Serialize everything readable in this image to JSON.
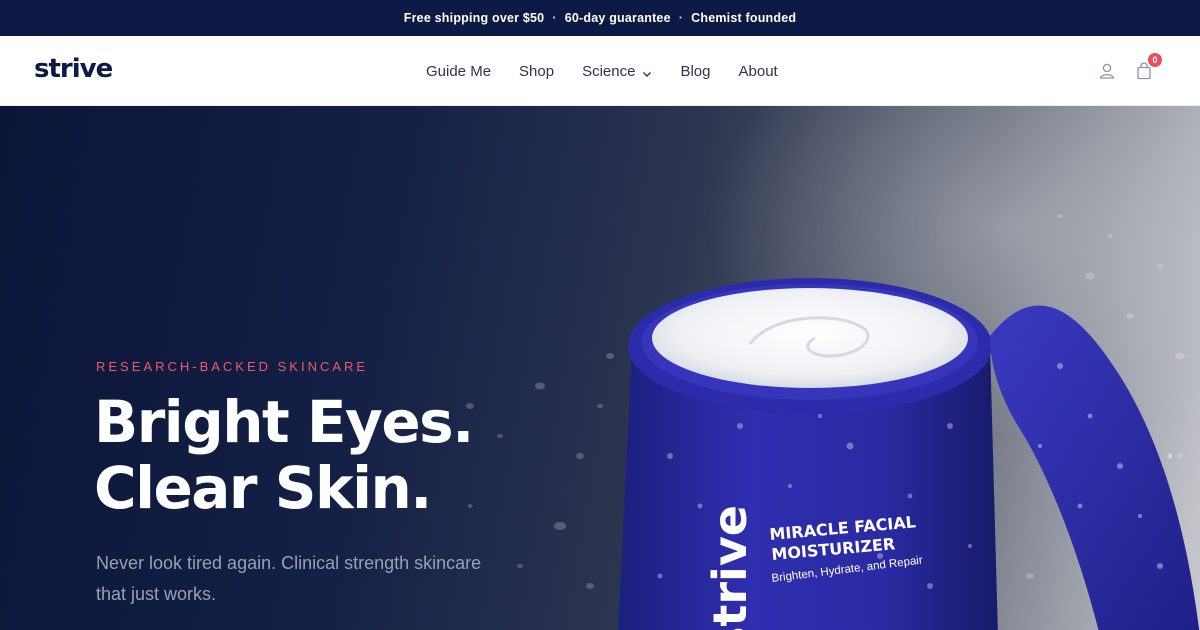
{
  "announcement": {
    "items": [
      "Free shipping over $50",
      "60-day guarantee",
      "Chemist founded"
    ],
    "separator": "·"
  },
  "header": {
    "logo": "strive",
    "nav": [
      {
        "label": "Guide Me"
      },
      {
        "label": "Shop"
      },
      {
        "label": "Science",
        "has_dropdown": true
      },
      {
        "label": "Blog"
      },
      {
        "label": "About"
      }
    ],
    "cart_count": "0",
    "icons": [
      "user-icon",
      "cart-icon",
      "chevron-down-icon"
    ]
  },
  "hero": {
    "eyebrow": "RESEARCH-BACKED SKINCARE",
    "headline_line1": "Bright Eyes.",
    "headline_line2": "Clear Skin.",
    "subcopy": "Never look tired again. Clinical strength skincare that just works.",
    "product": {
      "brand": "strive",
      "name_line1": "MIRACLE FACIAL",
      "name_line2": "MOISTURIZER",
      "tagline": "Brighten, Hydrate, and Repair"
    }
  },
  "colors": {
    "navy": "#0c1a45",
    "accent": "#ef5a63",
    "badge": "#ef4c5a",
    "jar_blue": "#2a2aa8"
  }
}
